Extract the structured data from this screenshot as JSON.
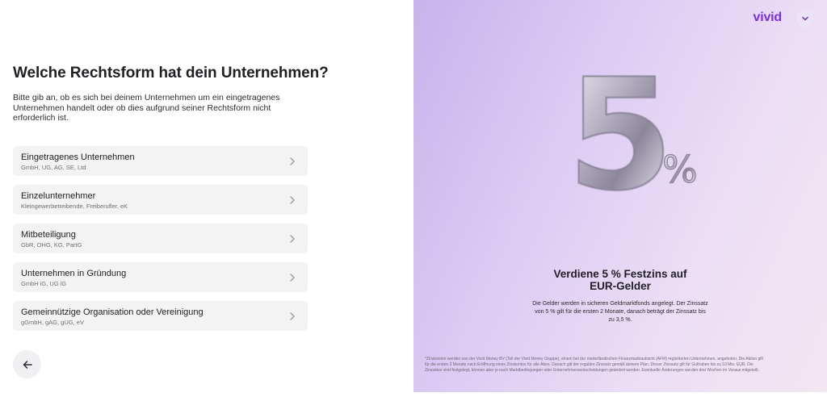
{
  "form": {
    "title": "Welche Rechtsform hat dein Unternehmen?",
    "description": "Bitte gib an, ob es sich bei deinem Unternehmen um ein eingetragenes Unternehmen handelt oder ob dies aufgrund seiner Rechtsform nicht erforderlich ist.",
    "options": [
      {
        "title": "Eingetragenes Unternehmen",
        "subtitle": "GmbH, UG, AG, SE, Ltd"
      },
      {
        "title": "Einzelunternehmer",
        "subtitle": "Kleingewerbetreibende, Freiberufler, eK"
      },
      {
        "title": "Mitbeteiligung",
        "subtitle": "GbR, OHG, KG, PartG"
      },
      {
        "title": "Unternehmen in Gründung",
        "subtitle": "GmbH iG, UG iG"
      },
      {
        "title": "Gemeinnützige Organisation oder Vereinigung",
        "subtitle": "gGmbH, gAG, gUG, eV"
      }
    ],
    "back_icon": "arrow-left-icon",
    "option_icon": "chevron-right-icon"
  },
  "promo": {
    "brand": "vivid",
    "language_icon": "chevron-down-icon",
    "balloon_number": "5",
    "balloon_percent": "%",
    "title_line1": "Verdiene 5 % Festzins auf",
    "title_line2": "EUR-Gelder",
    "text": "Die Gelder werden in sicheren Geldmarktfonds angelegt. Der Zinssatz von 5 % gilt für die ersten 2 Monate, danach beträgt der Zinssatz bis zu 3,5 %.",
    "footnote": "*Zinskonten werden von der Vivid Money BV (Teil der Vivid Money Gruppe), einem bei der niederländischen Finanzmarktaufsicht (AFM) registrierten Unternehmen, angeboten. Die Aktion gilt für die ersten 2 Monate nach Eröffnung eines Zinskontos für alle Abos. Danach gilt der reguläre Zinssatz gemäß deinem Plan. Dieser Zinssatz gilt für Guthaben bis zu 10 Mio. EUR. Die Zinssätze sind festgelegt, können aber je nach Marktbedingungen oder Unternehmensentscheidungen geändert werden. Eventuelle Änderungen werden drei Wochen im Voraus mitgeteilt."
  },
  "colors": {
    "brand": "#7a2cf0",
    "option_bg": "#f3f3f3",
    "panel_gradient_start": "#c8b3ec",
    "panel_gradient_end": "#f2e6f0"
  }
}
